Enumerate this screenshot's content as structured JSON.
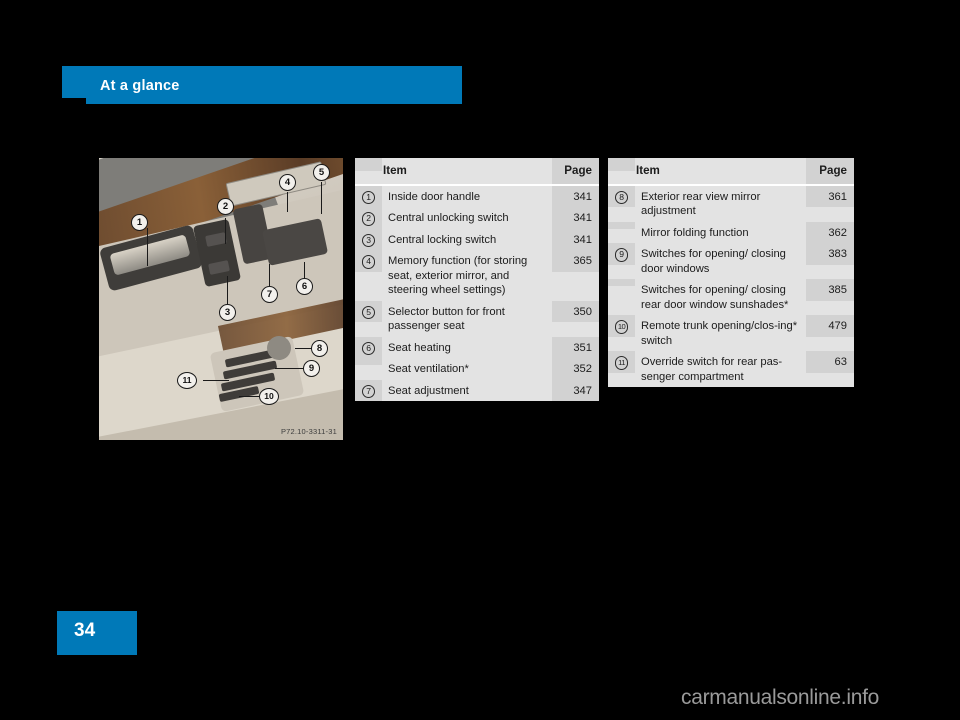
{
  "header": {
    "title": "At a glance"
  },
  "figure": {
    "name": "driver-door-panel-photo",
    "code": "P72.10-3311-31",
    "callouts": [
      "1",
      "2",
      "3",
      "4",
      "5",
      "6",
      "7",
      "8",
      "9",
      "10",
      "11"
    ]
  },
  "tables": [
    {
      "id": "table-left",
      "headers": {
        "num": "",
        "item": "Item",
        "page": "Page"
      },
      "rows": [
        {
          "num": "1",
          "item": "Inside door handle",
          "page": "341"
        },
        {
          "num": "2",
          "item": "Central unlocking switch",
          "page": "341"
        },
        {
          "num": "3",
          "item": "Central locking switch",
          "page": "341"
        },
        {
          "num": "4",
          "item": "Memory function (for storing seat, exterior mirror, and steering wheel settings)",
          "page": "365"
        },
        {
          "num": "5",
          "item": "Selector button for front passenger seat",
          "page": "350"
        },
        {
          "num": "6",
          "item": "Seat heating",
          "page": "351"
        },
        {
          "num": "",
          "item": "Seat ventilation*",
          "page": "352"
        },
        {
          "num": "7",
          "item": "Seat adjustment",
          "page": "347"
        }
      ]
    },
    {
      "id": "table-right",
      "headers": {
        "num": "",
        "item": "Item",
        "page": "Page"
      },
      "rows": [
        {
          "num": "8",
          "item": "Exterior rear view mirror adjustment",
          "page": "361"
        },
        {
          "num": "",
          "item": "Mirror folding function",
          "page": "362"
        },
        {
          "num": "9",
          "item": "Switches for opening/ closing door windows",
          "page": "383"
        },
        {
          "num": "",
          "item": "Switches for opening/ closing rear door window sunshades*",
          "page": "385"
        },
        {
          "num": "10",
          "item": "Remote trunk opening/clos-ing* switch",
          "page": "479"
        },
        {
          "num": "11",
          "item": "Override switch for rear pas-senger compartment",
          "page": "63"
        }
      ]
    }
  ],
  "footer": {
    "page_number": "34",
    "watermark": "carmanualsonline.info"
  },
  "colors": {
    "accent_blue": "#0079b8",
    "table_item_bg": "#e3e3e3",
    "table_side_bg": "#d2d2d2",
    "page_bg": "#000000"
  }
}
